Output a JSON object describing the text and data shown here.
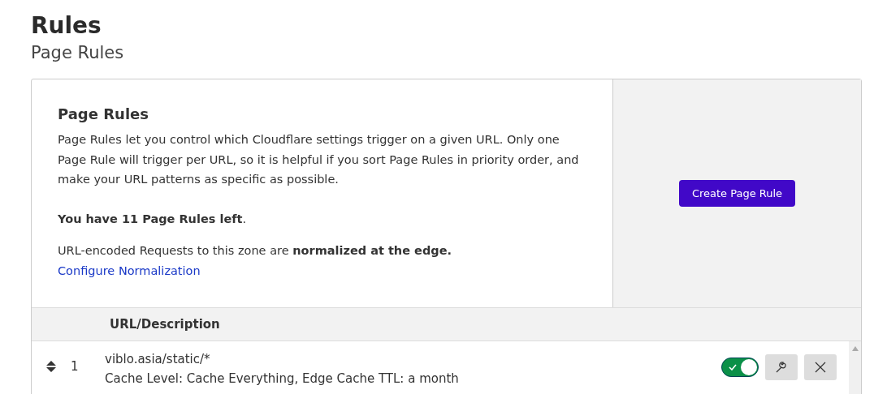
{
  "page": {
    "title": "Rules",
    "subtitle": "Page Rules"
  },
  "intro": {
    "heading": "Page Rules",
    "description": "Page Rules let you control which Cloudflare settings trigger on a given URL. Only one Page Rule will trigger per URL, so it is helpful if you sort Page Rules in priority order, and make your URL patterns as specific as possible.",
    "remaining": "**You have 11 Page Rules left**.",
    "normalization": "URL-encoded Requests to this zone are **normalized at the edge.**",
    "link": "Configure Normalization",
    "button": "Create Page Rule"
  },
  "table": {
    "columns": [
      "URL/Description"
    ],
    "rows": [
      {
        "priority": "1",
        "url": "viblo.asia/static/*",
        "description": "Cache Level: Cache Everything, Edge Cache TTL: a month",
        "on": true
      }
    ]
  }
}
